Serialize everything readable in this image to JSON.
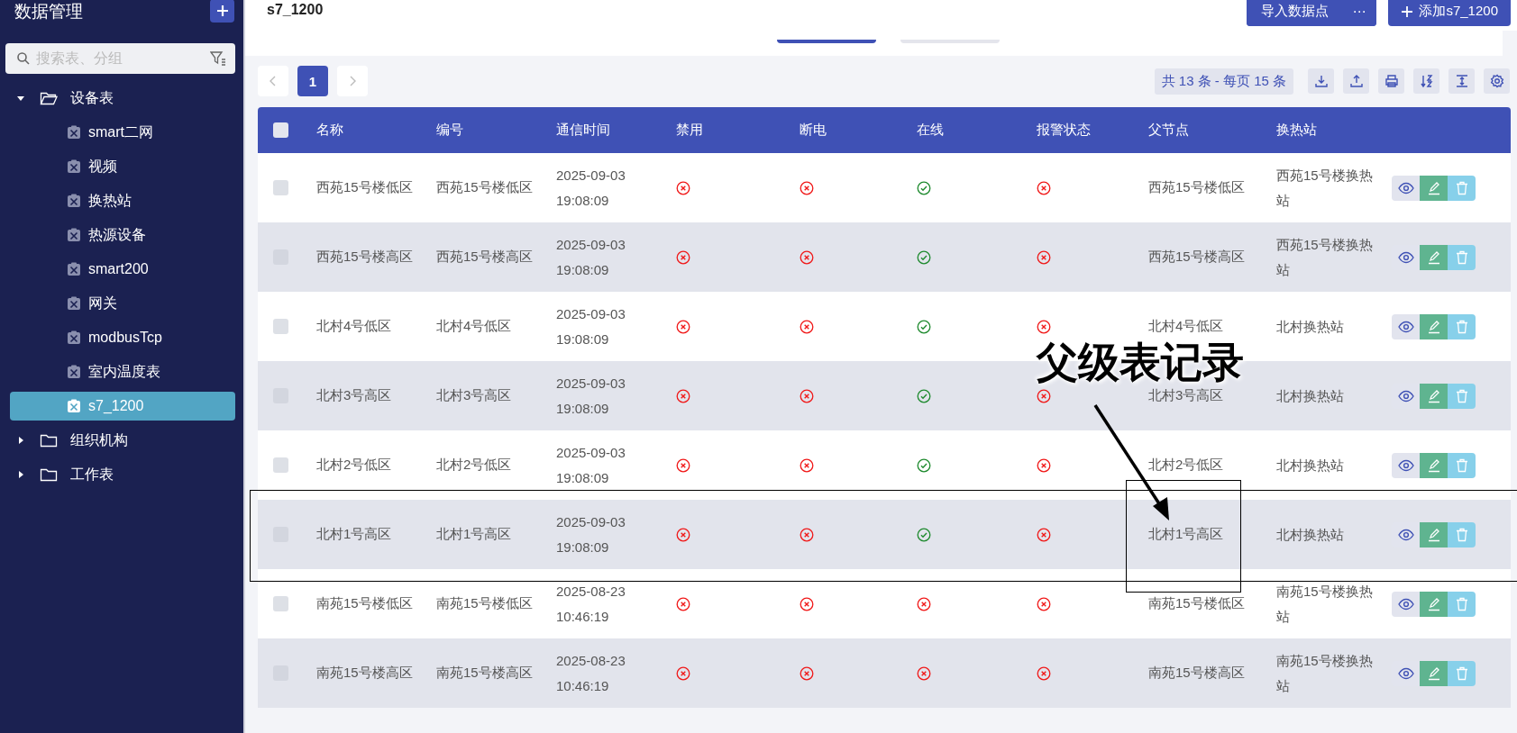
{
  "sidebar": {
    "title": "数据管理",
    "search": {
      "placeholder": "搜索表、分组"
    },
    "tree": [
      {
        "label": "设备表",
        "expanded": true,
        "selected": false,
        "children": [
          {
            "label": "smart二网",
            "selected": false
          },
          {
            "label": "视频",
            "selected": false
          },
          {
            "label": "换热站",
            "selected": false
          },
          {
            "label": "热源设备",
            "selected": false
          },
          {
            "label": "smart200",
            "selected": false
          },
          {
            "label": "网关",
            "selected": false
          },
          {
            "label": "modbusTcp",
            "selected": false
          },
          {
            "label": "室内温度表",
            "selected": false
          },
          {
            "label": "s7_1200",
            "selected": true
          }
        ]
      },
      {
        "label": "组织机构",
        "expanded": false,
        "selected": false
      },
      {
        "label": "工作表",
        "expanded": false,
        "selected": false
      }
    ]
  },
  "page_title": "s7_1200",
  "header_buttons": {
    "import": "导入数据点",
    "more": "⋯",
    "add": "添加s7_1200"
  },
  "pagination": {
    "pages": [
      {
        "label": "1",
        "selected": true
      }
    ],
    "summary": "共 13 条 - 每页 15 条"
  },
  "table": {
    "select_all_checked": false,
    "columns": [
      "名称",
      "编号",
      "通信时间",
      "禁用",
      "断电",
      "在线",
      "报警状态",
      "父节点",
      "换热站"
    ],
    "rows": [
      {
        "checked": false,
        "name": "西苑15号楼低区",
        "code": "西苑15号楼低区",
        "time": "2025-09-03 19:08:09",
        "disabled": false,
        "power_off": false,
        "online": true,
        "alarm": false,
        "parent": "西苑15号楼低区",
        "station": "西苑15号楼换热站"
      },
      {
        "checked": false,
        "name": "西苑15号楼高区",
        "code": "西苑15号楼高区",
        "time": "2025-09-03 19:08:09",
        "disabled": false,
        "power_off": false,
        "online": true,
        "alarm": false,
        "parent": "西苑15号楼高区",
        "station": "西苑15号楼换热站"
      },
      {
        "checked": false,
        "name": "北村4号低区",
        "code": "北村4号低区",
        "time": "2025-09-03 19:08:09",
        "disabled": false,
        "power_off": false,
        "online": true,
        "alarm": false,
        "parent": "北村4号低区",
        "station": "北村换热站"
      },
      {
        "checked": false,
        "name": "北村3号高区",
        "code": "北村3号高区",
        "time": "2025-09-03 19:08:09",
        "disabled": false,
        "power_off": false,
        "online": true,
        "alarm": false,
        "parent": "北村3号高区",
        "station": "北村换热站"
      },
      {
        "checked": false,
        "name": "北村2号低区",
        "code": "北村2号低区",
        "time": "2025-09-03 19:08:09",
        "disabled": false,
        "power_off": false,
        "online": true,
        "alarm": false,
        "parent": "北村2号低区",
        "station": "北村换热站"
      },
      {
        "checked": false,
        "name": "北村1号高区",
        "code": "北村1号高区",
        "time": "2025-09-03 19:08:09",
        "disabled": false,
        "power_off": false,
        "online": true,
        "alarm": false,
        "parent": "北村1号高区",
        "station": "北村换热站"
      },
      {
        "checked": false,
        "name": "南苑15号楼低区",
        "code": "南苑15号楼低区",
        "time": "2025-08-23 10:46:19",
        "disabled": false,
        "power_off": false,
        "online": false,
        "alarm": false,
        "parent": "南苑15号楼低区",
        "station": "南苑15号楼换热站"
      },
      {
        "checked": false,
        "name": "南苑15号楼高区",
        "code": "南苑15号楼高区",
        "time": "2025-08-23 10:46:19",
        "disabled": false,
        "power_off": false,
        "online": false,
        "alarm": false,
        "parent": "南苑15号楼高区",
        "station": "南苑15号楼换热站"
      }
    ]
  },
  "annotation": {
    "text": "父级表记录"
  }
}
